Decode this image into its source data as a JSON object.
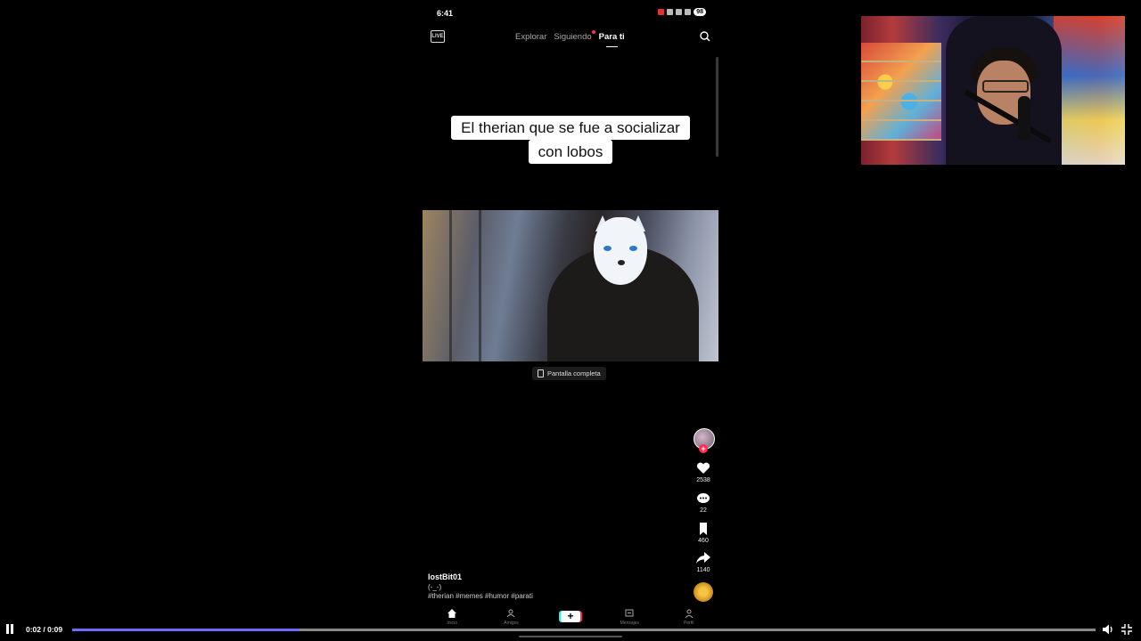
{
  "status_bar": {
    "time": "6:41",
    "battery": "98"
  },
  "top_nav": {
    "live_label": "LIVE",
    "tabs": [
      {
        "label": "Explorar"
      },
      {
        "label": "Siguiendo"
      },
      {
        "label": "Para ti"
      }
    ]
  },
  "caption": {
    "line1": "El therian que se fue a socializar",
    "line2": "con lobos"
  },
  "fullscreen": {
    "label": "Pantalla completa"
  },
  "actions": {
    "likes": "2538",
    "comments": "22",
    "saves": "460",
    "shares": "1140"
  },
  "post": {
    "username": "lostBit01",
    "description": "(-_-)",
    "hashtags": "#therian #memes #humor #parati"
  },
  "bottom_nav": {
    "items": [
      "Inicio",
      "Amigos",
      "",
      "Mensajes",
      "Perfil"
    ],
    "plus": "+"
  },
  "player": {
    "timecode": "0:02 / 0:09",
    "progress": 0.222
  },
  "colors": {
    "accent": "#6b6bff",
    "tiktok_red": "#ff2d55"
  }
}
